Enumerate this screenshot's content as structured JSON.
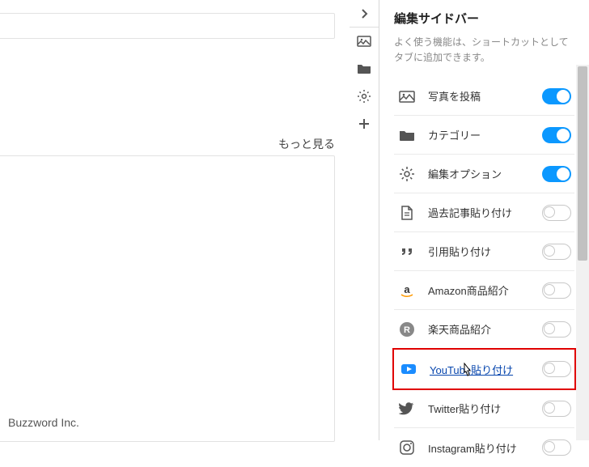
{
  "main": {
    "more_label": "もっと見る",
    "footer": "Buzzword Inc."
  },
  "sidebar": {
    "title": "編集サイドバー",
    "description": "よく使う機能は、ショートカットとしてタブに追加できます。",
    "features": [
      {
        "label": "写真を投稿",
        "enabled": true
      },
      {
        "label": "カテゴリー",
        "enabled": true
      },
      {
        "label": "編集オプション",
        "enabled": true
      },
      {
        "label": "過去記事貼り付け",
        "enabled": false
      },
      {
        "label": "引用貼り付け",
        "enabled": false
      },
      {
        "label": "Amazon商品紹介",
        "enabled": false
      },
      {
        "label": "楽天商品紹介",
        "enabled": false
      },
      {
        "label": "YouTube貼り付け",
        "enabled": false
      },
      {
        "label": "Twitter貼り付け",
        "enabled": false
      },
      {
        "label": "Instagram貼り付け",
        "enabled": false
      }
    ]
  },
  "colors": {
    "toggle_on": "#0b98ff",
    "highlight": "#e00000",
    "link": "#0645ad",
    "youtube": "#1a8cff",
    "twitter": "#4a4a4a",
    "rakuten": "#bf0000"
  }
}
